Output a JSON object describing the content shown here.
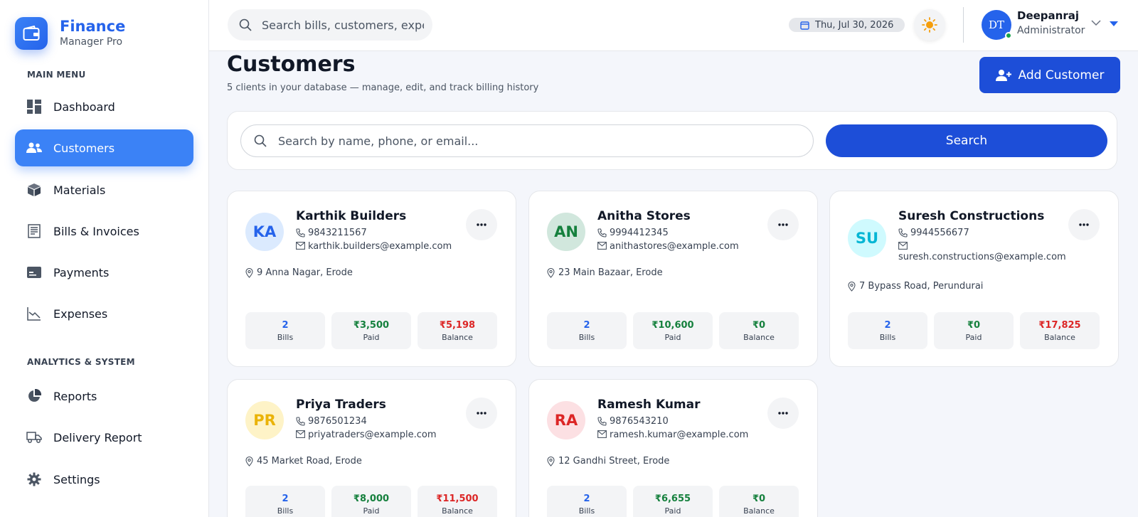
{
  "brand": {
    "title": "Finance",
    "subtitle": "Manager Pro"
  },
  "sidebar": {
    "main_menu_label": "MAIN MENU",
    "analytics_label": "ANALYTICS & SYSTEM",
    "items": [
      {
        "label": "Dashboard",
        "icon": "dashboard-icon"
      },
      {
        "label": "Customers",
        "icon": "users-icon",
        "active": true
      },
      {
        "label": "Materials",
        "icon": "box-icon"
      },
      {
        "label": "Bills & Invoices",
        "icon": "invoice-icon"
      },
      {
        "label": "Payments",
        "icon": "card-icon"
      },
      {
        "label": "Expenses",
        "icon": "chart-line-icon"
      },
      {
        "label": "Reports",
        "icon": "pie-chart-icon"
      },
      {
        "label": "Delivery Report",
        "icon": "truck-icon"
      },
      {
        "label": "Settings",
        "icon": "gear-icon"
      }
    ]
  },
  "topbar": {
    "search_placeholder": "Search bills, customers, expenses",
    "date": "Thu, Jul 30, 2026",
    "user": {
      "initials": "DT",
      "name": "Deepanraj",
      "role": "Administrator"
    }
  },
  "page": {
    "title": "Customers",
    "subtitle": "5 clients in your database — manage, edit, and track billing history",
    "add_button": "Add Customer"
  },
  "customer_search": {
    "placeholder": "Search by name, phone, or email...",
    "button": "Search"
  },
  "stat_labels": {
    "bills": "Bills",
    "paid": "Paid",
    "balance": "Balance"
  },
  "customers": [
    {
      "initials": "KA",
      "name": "Karthik Builders",
      "phone": "9843211567",
      "email": "karthik.builders@example.com",
      "address": "9 Anna Nagar, Erode",
      "bills": "2",
      "paid": "₹3,500",
      "balance": "₹5,198"
    },
    {
      "initials": "AN",
      "name": "Anitha Stores",
      "phone": "9994412345",
      "email": "anithastores@example.com",
      "address": "23 Main Bazaar, Erode",
      "bills": "2",
      "paid": "₹10,600",
      "balance": "₹0"
    },
    {
      "initials": "SU",
      "name": "Suresh Constructions",
      "phone": "9944556677",
      "email": "suresh.constructions@example.com",
      "address": "7 Bypass Road, Perundurai",
      "bills": "2",
      "paid": "₹0",
      "balance": "₹17,825"
    },
    {
      "initials": "PR",
      "name": "Priya Traders",
      "phone": "9876501234",
      "email": "priyatraders@example.com",
      "address": "45 Market Road, Erode",
      "bills": "2",
      "paid": "₹8,000",
      "balance": "₹11,500"
    },
    {
      "initials": "RA",
      "name": "Ramesh Kumar",
      "phone": "9876543210",
      "email": "ramesh.kumar@example.com",
      "address": "12 Gandhi Street, Erode",
      "bills": "2",
      "paid": "₹6,655",
      "balance": "₹0"
    }
  ],
  "colors": {
    "accent": "#1d4ed8",
    "active_nav": "#3b82f6",
    "bills": "#2563eb",
    "paid": "#15803d",
    "balance_due": "#dc2626",
    "balance_zero": "#15803d"
  }
}
